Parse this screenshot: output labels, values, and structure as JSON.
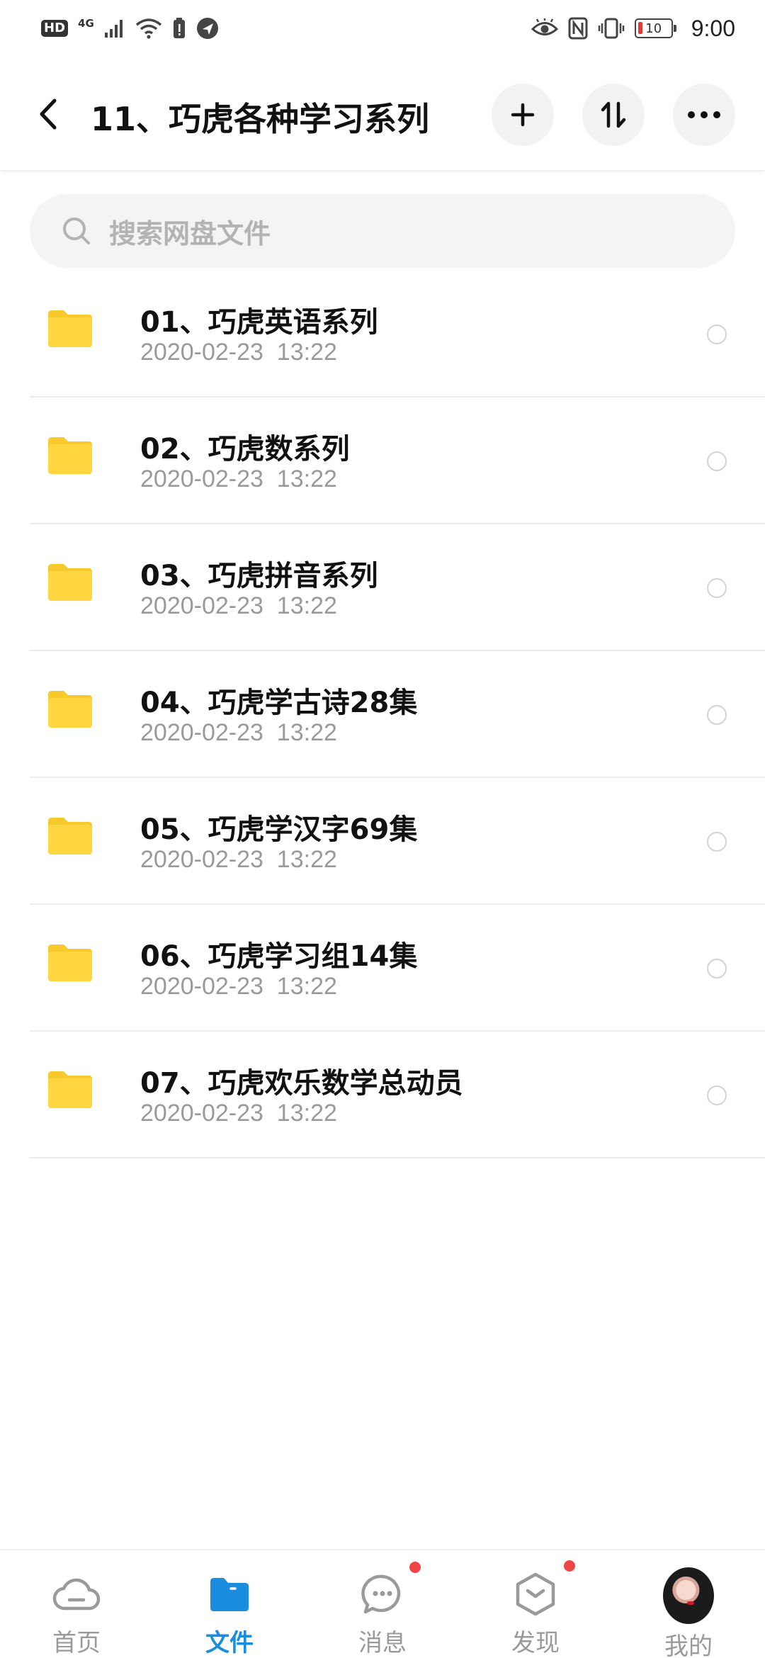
{
  "status_bar": {
    "hd": "HD",
    "network": "4G",
    "battery": "10",
    "time": "9:00"
  },
  "header": {
    "title": "11、巧虎各种学习系列"
  },
  "search": {
    "placeholder": "搜索网盘文件"
  },
  "files": [
    {
      "name": "01、巧虎英语系列",
      "date": "2020-02-23  13:22"
    },
    {
      "name": "02、巧虎数系列",
      "date": "2020-02-23  13:22"
    },
    {
      "name": "03、巧虎拼音系列",
      "date": "2020-02-23  13:22"
    },
    {
      "name": "04、巧虎学古诗28集",
      "date": "2020-02-23  13:22"
    },
    {
      "name": "05、巧虎学汉字69集",
      "date": "2020-02-23  13:22"
    },
    {
      "name": "06、巧虎学习组14集",
      "date": "2020-02-23  13:22"
    },
    {
      "name": "07、巧虎欢乐数学总动员",
      "date": "2020-02-23  13:22"
    }
  ],
  "nav": {
    "items": [
      {
        "label": "首页",
        "icon": "cloud-icon"
      },
      {
        "label": "文件",
        "icon": "folder-icon"
      },
      {
        "label": "消息",
        "icon": "chat-icon"
      },
      {
        "label": "发现",
        "icon": "discover-icon"
      },
      {
        "label": "我的",
        "icon": "avatar"
      }
    ]
  },
  "colors": {
    "accent": "#1a8dde",
    "folder": "#ffd43b",
    "badge": "#f04545"
  }
}
